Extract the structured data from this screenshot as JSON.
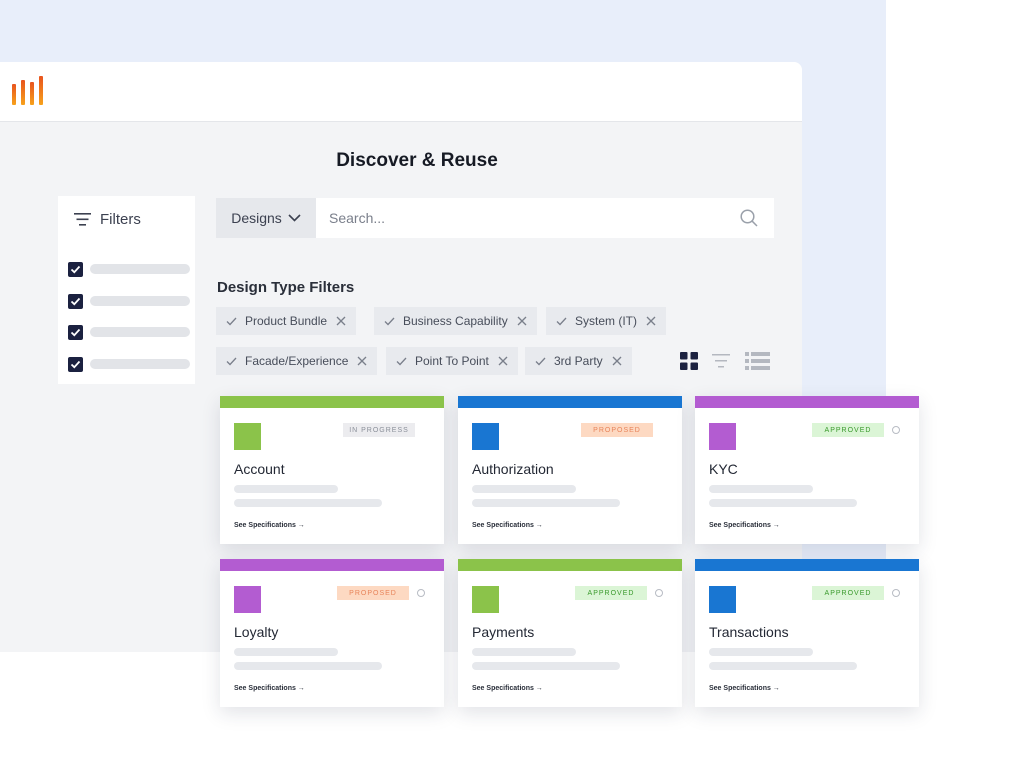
{
  "colors": {
    "green": "#8bc34a",
    "blue": "#1976d2",
    "purple": "#b35cd1",
    "navy": "#1b2140",
    "proposed_bg": "#fdd9c2",
    "proposed_fg": "#e8845a",
    "approved_bg": "#dbf5d6",
    "approved_fg": "#3a9a2c",
    "progress_bg": "#ececef",
    "progress_fg": "#8a8f99"
  },
  "app": {
    "logo_icon": "bar-logo-icon"
  },
  "page": {
    "title": "Discover & Reuse"
  },
  "filters": {
    "label": "Filters",
    "icon": "filter-lines-icon",
    "items": [
      {
        "checked": true
      },
      {
        "checked": true
      },
      {
        "checked": true
      },
      {
        "checked": true
      }
    ]
  },
  "search": {
    "type_label": "Designs",
    "placeholder": "Search...",
    "value": "",
    "icon": "search-icon"
  },
  "design_type_filters": {
    "title": "Design Type Filters",
    "chips": [
      {
        "label": "Product Bundle"
      },
      {
        "label": "Business Capability"
      },
      {
        "label": "System  (IT)"
      },
      {
        "label": "Facade/Experience"
      },
      {
        "label": "Point To Point"
      },
      {
        "label": "3rd Party"
      }
    ]
  },
  "view_toggles": {
    "grid_icon": "grid-view-icon",
    "filter_icon": "sort-lines-icon",
    "list_icon": "list-view-icon",
    "active": "grid"
  },
  "cards": [
    {
      "title": "Account",
      "status": "IN PROGRESS",
      "status_type": "progress",
      "color": "green",
      "link": "See Specifications →",
      "has_radio": false
    },
    {
      "title": "Authorization",
      "status": "PROPOSED",
      "status_type": "proposed",
      "color": "blue",
      "link": "See Specifications →",
      "has_radio": false
    },
    {
      "title": "KYC",
      "status": "APPROVED",
      "status_type": "approved",
      "color": "purple",
      "link": "See Specifications →",
      "has_radio": true
    },
    {
      "title": "Loyalty",
      "status": "PROPOSED",
      "status_type": "proposed",
      "color": "purple",
      "link": "See Specifications →",
      "has_radio": true
    },
    {
      "title": "Payments",
      "status": "APPROVED",
      "status_type": "approved",
      "color": "green",
      "link": "See Specifications →",
      "has_radio": true
    },
    {
      "title": "Transactions",
      "status": "APPROVED",
      "status_type": "approved",
      "color": "blue",
      "link": "See Specifications →",
      "has_radio": true
    }
  ]
}
